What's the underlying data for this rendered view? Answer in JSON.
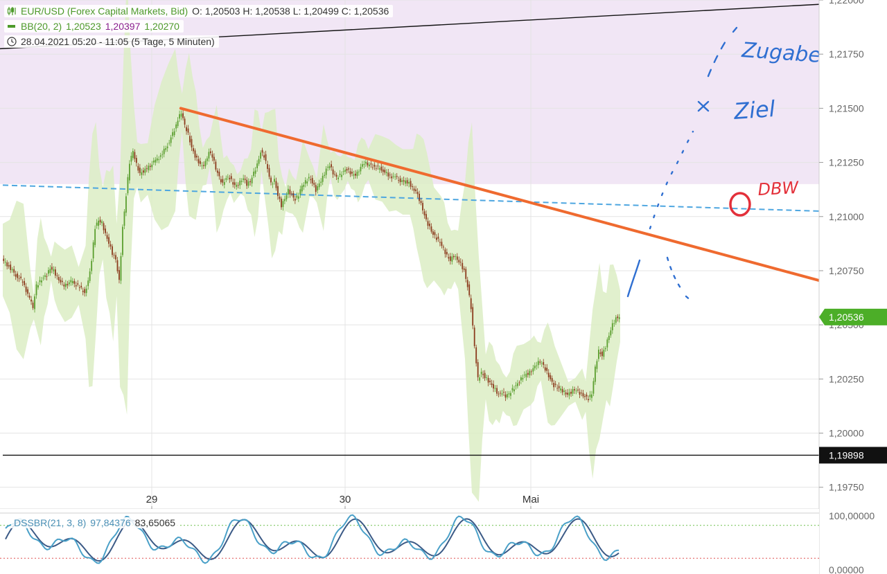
{
  "legend": {
    "instrument": "EUR/USD (Forex Capital Markets, Bid)",
    "ohlc": "O: 1,20503  H: 1,20538  L: 1,20499  C: 1,20536",
    "bb_label": "BB(20, 2)",
    "bb_v1": "1,20523",
    "bb_v2": "1,20397",
    "bb_v3": "1,20270",
    "period": "28.04.2021 05:20 - 11:05  (5 Tage, 5 Minuten)"
  },
  "indicator": {
    "label": "DSSBR(21, 3, 8)",
    "value1": "97,84376",
    "value2": "83,65065",
    "y_ticks": [
      "100,00000",
      "0,00000"
    ]
  },
  "annotations": {
    "zugabe": "Zugabe",
    "ziel": "Ziel",
    "dbw": "DBW"
  },
  "colors": {
    "candle_up": "#5a9e2e",
    "candle_down": "#8b3a1c",
    "bb_fill": "#dcedc4",
    "zone_fill": "#f1e6f5",
    "trendline": "#ef6a2f",
    "dashed_line": "#4da6e0",
    "handwriting": "#2f6fd1",
    "dbw_red": "#e3303a",
    "price_tag": "#4cae28"
  },
  "chart_data": {
    "type": "line",
    "title": "EUR/USD (Forex Capital Markets, Bid)",
    "x_tick_labels": [
      "29",
      "30",
      "Mai"
    ],
    "y_tick_labels": [
      "1,22000",
      "1,21750",
      "1,21500",
      "1,21250",
      "1,21000",
      "1,20750",
      "1,20500",
      "1,20250",
      "1,20000",
      "1,19750"
    ],
    "ylim": [
      1.1965,
      1.22
    ],
    "current_price_label": "1,20536",
    "current_price": 1.20536,
    "support_label": "1,19898",
    "support_price": 1.19898,
    "resistance_zone": [
      1.2115,
      1.22
    ],
    "series": [
      {
        "name": "EUR/USD",
        "x": [
          0,
          10,
          20,
          30,
          40,
          45,
          50,
          55,
          60,
          65,
          70,
          75,
          80,
          90,
          100,
          110,
          120,
          125,
          130,
          135,
          140,
          145,
          150,
          155,
          160,
          165,
          170,
          175,
          180,
          185,
          190,
          195,
          200,
          210,
          220,
          230,
          240,
          250,
          255,
          260,
          265,
          270,
          275,
          280,
          285,
          290,
          295,
          300,
          305,
          310,
          315,
          320,
          325,
          330,
          335,
          340,
          345,
          350,
          355,
          360,
          365,
          370,
          375,
          380,
          385,
          390,
          395,
          400,
          405,
          410,
          415,
          420,
          425,
          430,
          435,
          440,
          445,
          450,
          455,
          460,
          465,
          470,
          475,
          480,
          485,
          490,
          495,
          500,
          505,
          510,
          515,
          520,
          525,
          530,
          540,
          550,
          560,
          570,
          580,
          590,
          595,
          600,
          605,
          610,
          615,
          620,
          625,
          630,
          635,
          640,
          645,
          650,
          655,
          660,
          665,
          670,
          675,
          680,
          685,
          690,
          695,
          700,
          705,
          710,
          715,
          720,
          725,
          730,
          735,
          740,
          745,
          750,
          755,
          760,
          765,
          770,
          775,
          780,
          785,
          790,
          795,
          800,
          805,
          810,
          815,
          820,
          825,
          830,
          835,
          840,
          845,
          850,
          855,
          860,
          865,
          870,
          875,
          880,
          885,
          890,
          895
        ],
        "y": [
          1.208,
          1.2077,
          1.2073,
          1.207,
          1.2062,
          1.2058,
          1.2068,
          1.207,
          1.2072,
          1.2073,
          1.2076,
          1.2075,
          1.2072,
          1.2068,
          1.207,
          1.2068,
          1.2065,
          1.207,
          1.208,
          1.2095,
          1.2098,
          1.2097,
          1.2092,
          1.2088,
          1.2083,
          1.208,
          1.207,
          1.2095,
          1.211,
          1.2125,
          1.213,
          1.2124,
          1.212,
          1.2122,
          1.2125,
          1.2128,
          1.2133,
          1.214,
          1.2145,
          1.2148,
          1.2142,
          1.2138,
          1.2132,
          1.2128,
          1.2125,
          1.2123,
          1.2125,
          1.213,
          1.2128,
          1.2122,
          1.2118,
          1.2115,
          1.2118,
          1.2118,
          1.2115,
          1.2114,
          1.2116,
          1.2118,
          1.2115,
          1.2116,
          1.212,
          1.2124,
          1.213,
          1.2128,
          1.2122,
          1.2115,
          1.2117,
          1.211,
          1.2105,
          1.2108,
          1.2112,
          1.211,
          1.2108,
          1.211,
          1.2114,
          1.2116,
          1.2118,
          1.2116,
          1.2112,
          1.2115,
          1.2118,
          1.2122,
          1.2124,
          1.212,
          1.2118,
          1.2119,
          1.2121,
          1.2122,
          1.212,
          1.2119,
          1.212,
          1.2123,
          1.2125,
          1.2124,
          1.2123,
          1.2122,
          1.2119,
          1.2118,
          1.2116,
          1.2116,
          1.2113,
          1.2112,
          1.2108,
          1.2103,
          1.2098,
          1.2095,
          1.2092,
          1.209,
          1.2088,
          1.2085,
          1.2082,
          1.208,
          1.2082,
          1.208,
          1.2078,
          1.2075,
          1.2068,
          1.2058,
          1.204,
          1.2025,
          1.2028,
          1.2026,
          1.2024,
          1.2022,
          1.202,
          1.2018,
          1.2019,
          1.2017,
          1.2018,
          1.202,
          1.2022,
          1.2024,
          1.2026,
          1.2027,
          1.2028,
          1.203,
          1.2032,
          1.2033,
          1.2031,
          1.2028,
          1.2025,
          1.2022,
          1.2021,
          1.202,
          1.2019,
          1.2018,
          1.2019,
          1.202,
          1.2019,
          1.2018,
          1.2017,
          1.2016,
          1.2018,
          1.203,
          1.2038,
          1.2036,
          1.204,
          1.2045,
          1.205,
          1.2053,
          1.2054
        ]
      }
    ],
    "oscillator": {
      "name": "DSSBR(21, 3, 8)",
      "ylim": [
        0,
        100
      ]
    }
  }
}
